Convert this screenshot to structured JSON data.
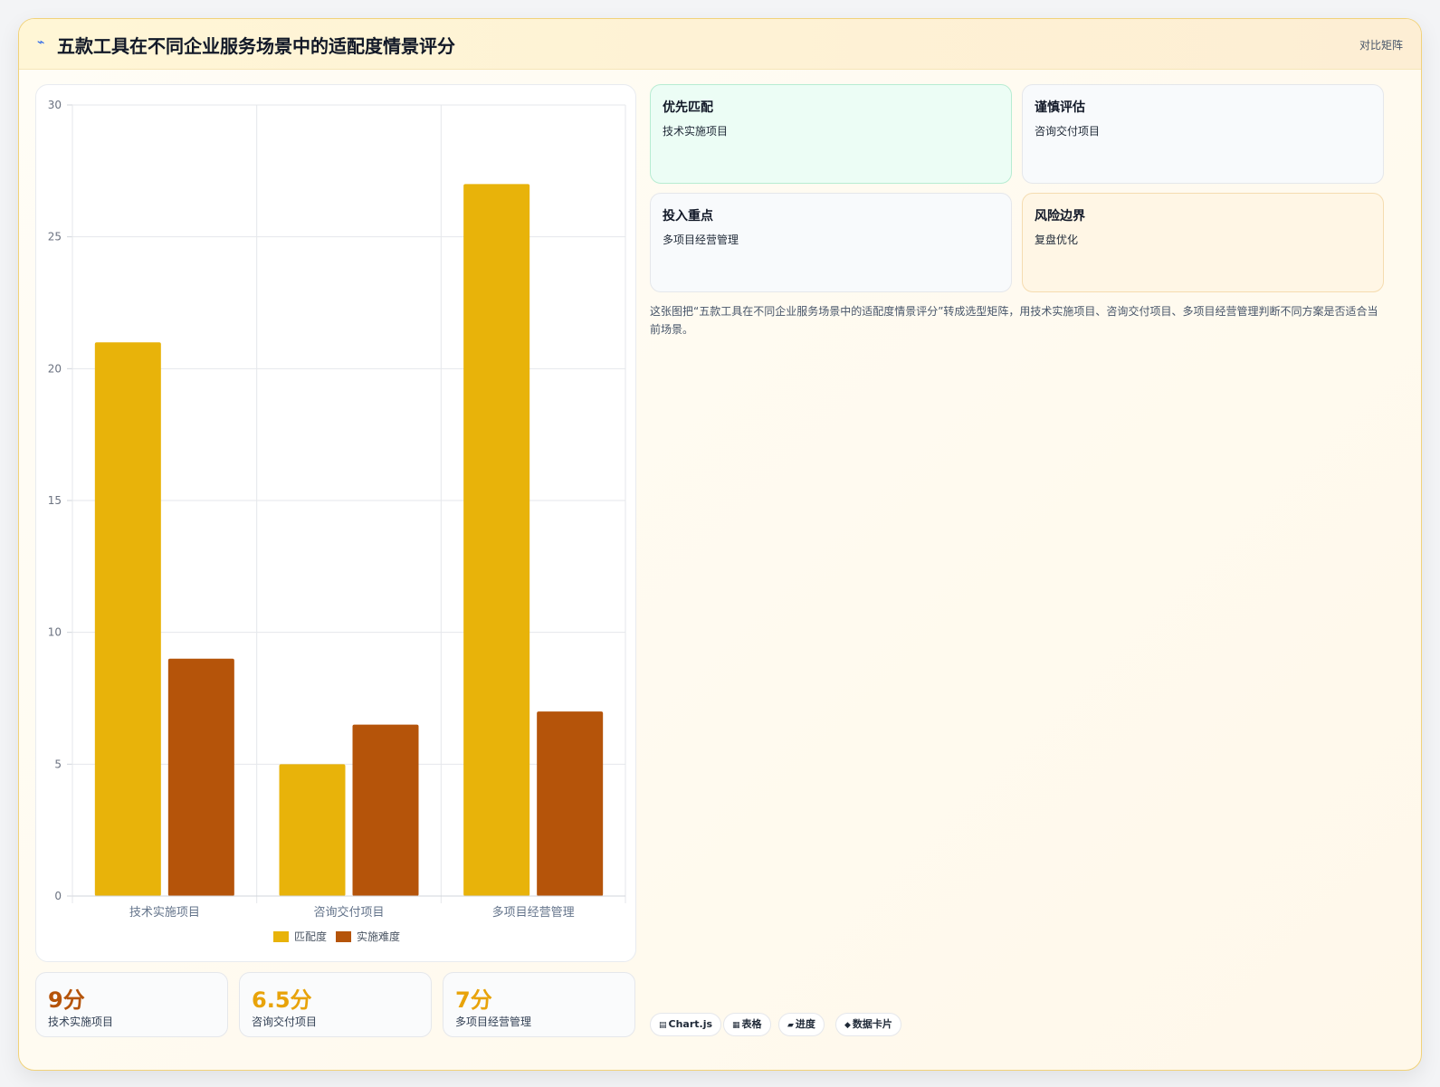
{
  "header": {
    "icon": "trend-icon",
    "title": "五款工具在不同企业服务场景中的适配度情景评分",
    "tag": "对比矩阵"
  },
  "colors": {
    "series_match": "#e8b30a",
    "series_difficulty": "#b5540a",
    "positive_bg": "#ecfdf5",
    "risk_bg": "#fff6e5"
  },
  "chart_data": {
    "type": "bar",
    "categories": [
      "技术实施项目",
      "咨询交付项目",
      "多项目经营管理"
    ],
    "series": [
      {
        "name": "匹配度",
        "values": [
          21,
          5,
          27
        ]
      },
      {
        "name": "实施难度",
        "values": [
          9,
          6.5,
          7
        ]
      }
    ],
    "title": "",
    "xlabel": "",
    "ylabel": "",
    "ylim": [
      0,
      30
    ],
    "yticks": [
      "0",
      "5",
      "10",
      "15",
      "20",
      "25",
      "30"
    ],
    "grid": true,
    "legend": "bottom"
  },
  "kpis": [
    {
      "value": "9分",
      "label": "技术实施项目",
      "color": "#b5540a"
    },
    {
      "value": "6.5分",
      "label": "咨询交付项目",
      "color": "#e8a30a"
    },
    {
      "value": "7分",
      "label": "多项目经营管理",
      "color": "#e8a30a"
    }
  ],
  "boxes": [
    {
      "title": "优先匹配",
      "subtitle": "技术实施项目"
    },
    {
      "title": "谨慎评估",
      "subtitle": "咨询交付项目"
    },
    {
      "title": "投入重点",
      "subtitle": "多项目经营管理"
    },
    {
      "title": "风险边界",
      "subtitle": "复盘优化"
    }
  ],
  "description": "这张图把“五款工具在不同企业服务场景中的适配度情景评分”转成选型矩阵，用技术实施项目、咨询交付项目、多项目经营管理判断不同方案是否适合当前场景。",
  "pills": [
    {
      "icon": "chart-icon",
      "glyph": "▤",
      "label": "Chart.js"
    },
    {
      "icon": "table-icon",
      "glyph": "▦",
      "label": "表格"
    },
    {
      "icon": "progress-icon",
      "glyph": "▰",
      "label": "进度"
    },
    {
      "icon": "card-icon",
      "glyph": "◆",
      "label": "数据卡片"
    }
  ]
}
